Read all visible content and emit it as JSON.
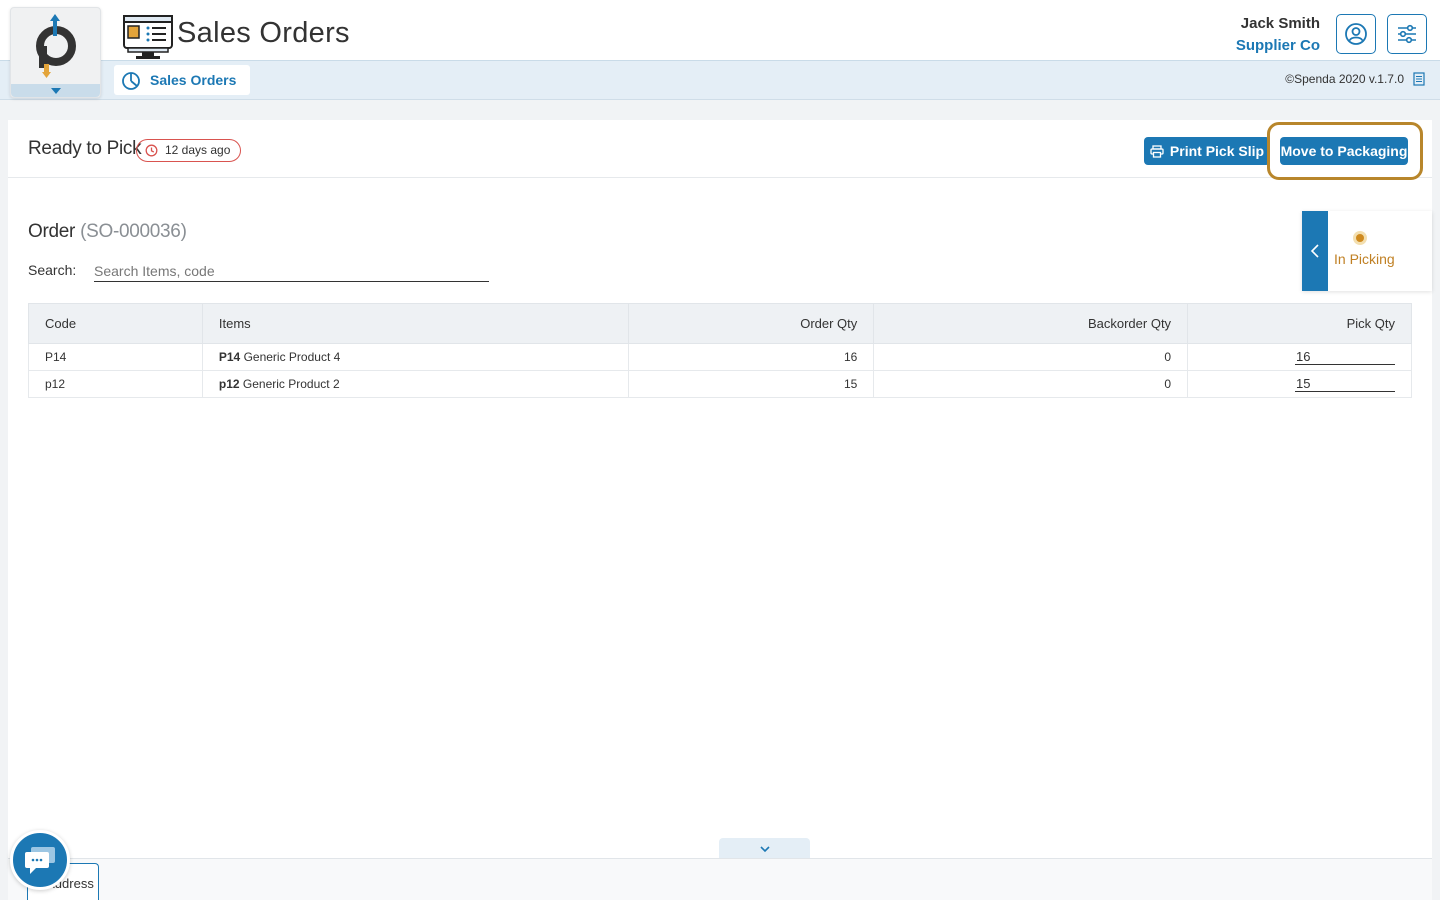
{
  "app": {
    "title": "Sales Orders",
    "tab_label": "Sales Orders",
    "copyright": "©Spenda 2020 v.1.7.0"
  },
  "user": {
    "name": "Jack Smith",
    "company": "Supplier Co"
  },
  "status": {
    "title": "Ready to Pick",
    "time_badge": "12 days ago",
    "side_label": "In Picking"
  },
  "actions": {
    "print_label": "Print Pick Slip",
    "move_label": "Move to Packaging"
  },
  "order": {
    "label": "Order",
    "code": "(SO-000036)"
  },
  "search": {
    "label": "Search:",
    "placeholder": "Search Items, code"
  },
  "table": {
    "headers": [
      "Code",
      "Items",
      "Order Qty",
      "Backorder Qty",
      "Pick Qty"
    ],
    "rows": [
      {
        "code": "P14",
        "item_code": "P14",
        "item_name": "Generic Product 4",
        "order_qty": "16",
        "backorder_qty": "0",
        "pick_qty": "16"
      },
      {
        "code": "p12",
        "item_code": "p12",
        "item_name": "Generic Product 2",
        "order_qty": "15",
        "backorder_qty": "0",
        "pick_qty": "15"
      }
    ]
  },
  "bottom": {
    "tab_label": "Address"
  },
  "colors": {
    "brand": "#1c78b4",
    "highlight": "#b8862b",
    "status_dot": "#cf8a1f",
    "badge_border": "#d9534f"
  },
  "icons": {
    "logo": "spenda-logo",
    "app": "sales-orders-icon",
    "user": "user-circle-icon",
    "settings": "sliders-icon",
    "print": "printer-icon",
    "clock": "clock-icon",
    "chat": "chat-icon"
  }
}
